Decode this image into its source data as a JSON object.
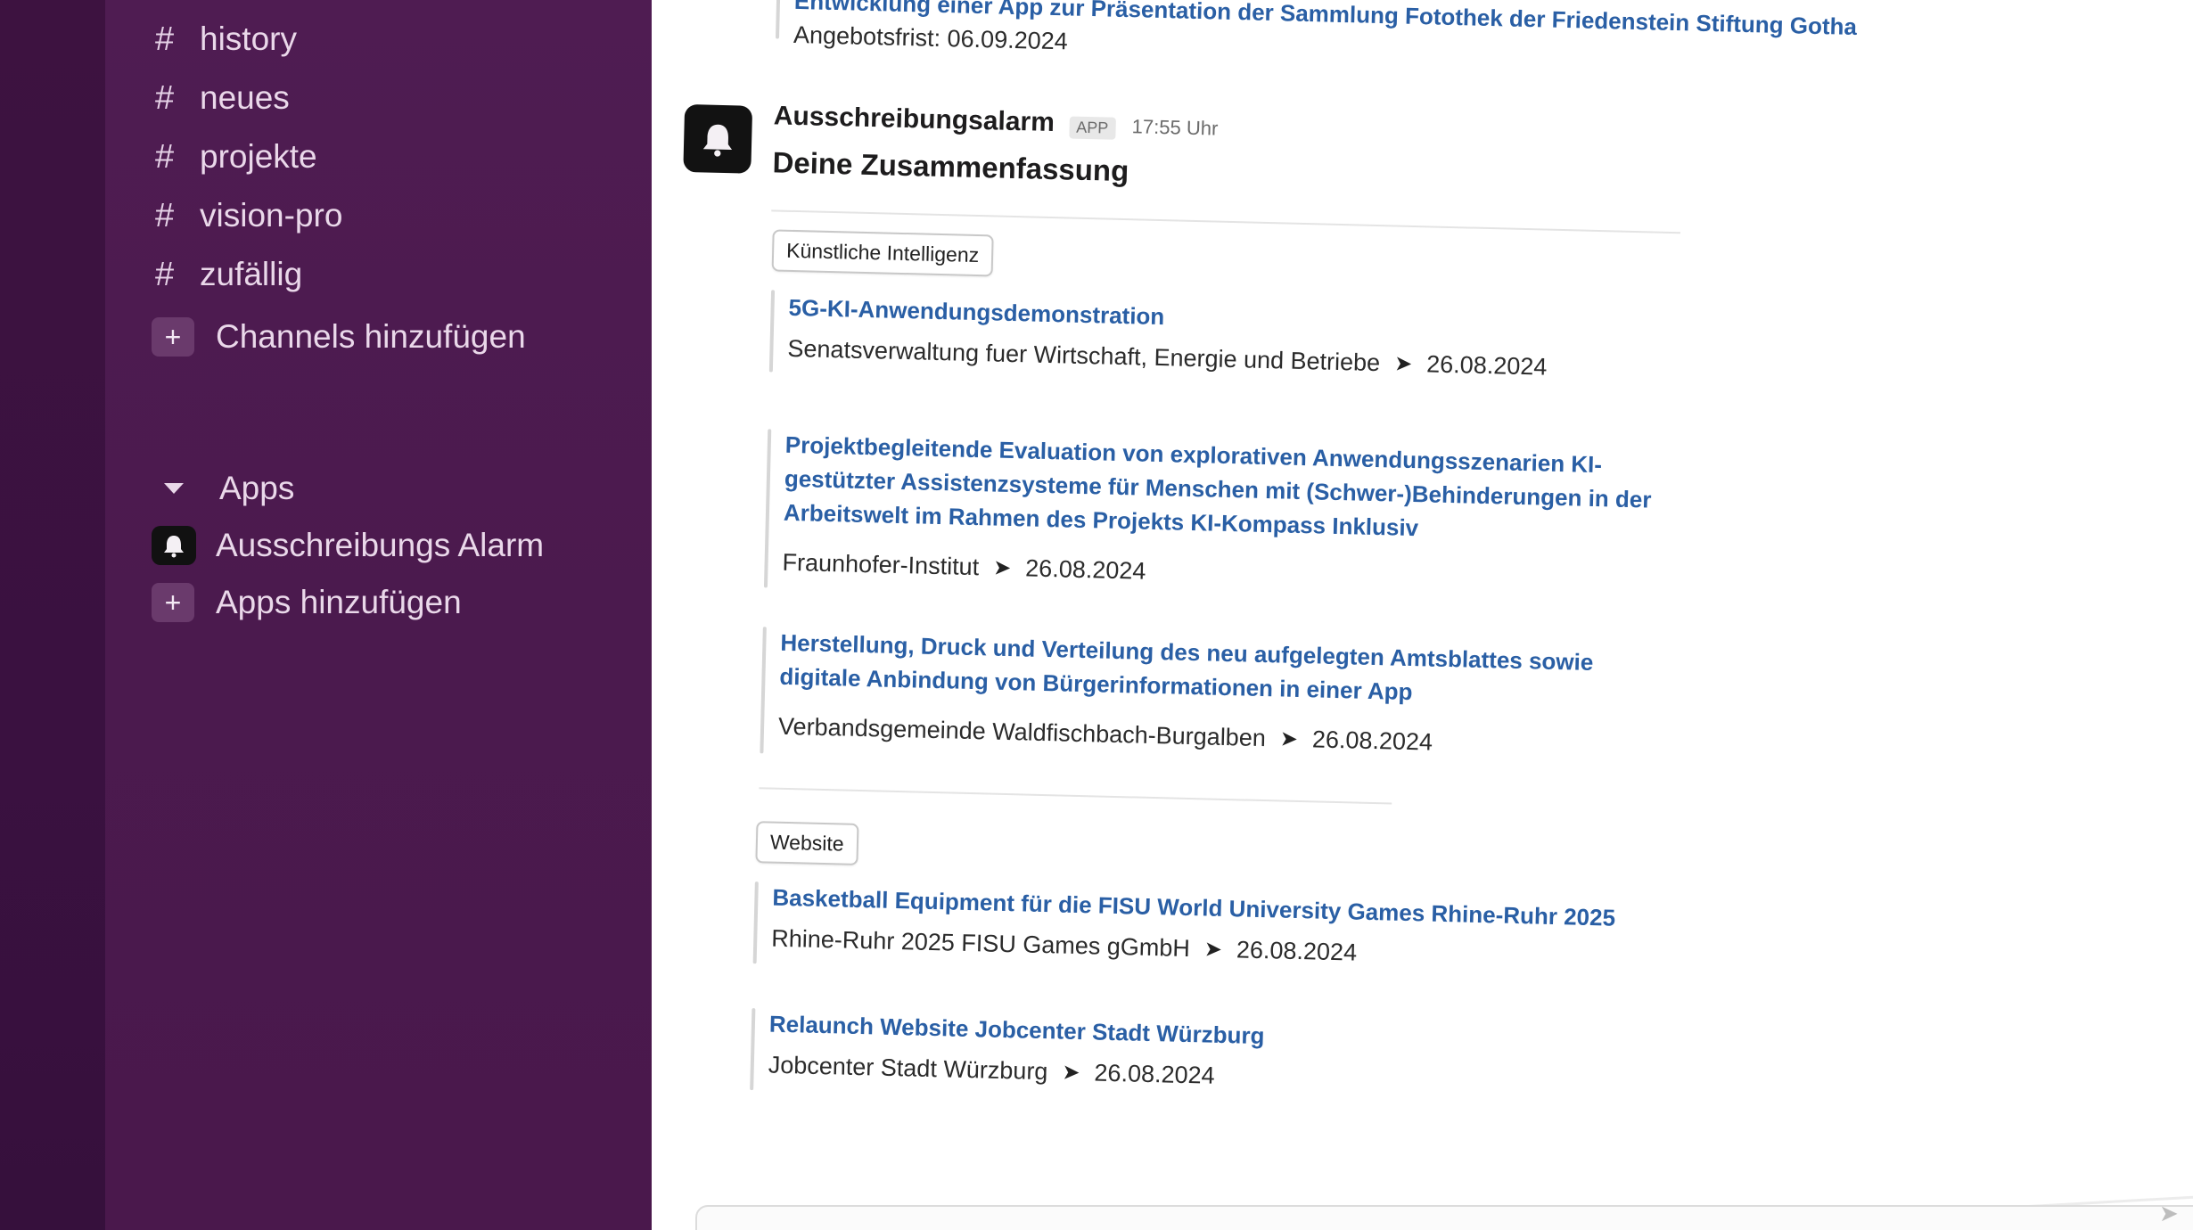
{
  "sidebar": {
    "channels": [
      "history",
      "neues",
      "projekte",
      "vision-pro",
      "zufällig"
    ],
    "add_channels_label": "Channels hinzufügen",
    "apps_header": "Apps",
    "apps": [
      "Ausschreibungs Alarm"
    ],
    "add_apps_label": "Apps hinzufügen"
  },
  "previous_message": {
    "link_fragment": "Entwicklung einer App zur Präsentation der Sammlung Fotothek der Friedenstein Stiftung Gotha",
    "deadline": "Angebotsfrist: 06.09.2024"
  },
  "message": {
    "sender": "Ausschreibungsalarm",
    "badge": "APP",
    "time": "17:55 Uhr",
    "title": "Deine Zusammenfassung",
    "sections": [
      {
        "tag": "Künstliche Intelligenz",
        "items": [
          {
            "title": "5G-KI-Anwendungsdemonstration",
            "org": "Senatsverwaltung fuer Wirtschaft, Energie und Betriebe",
            "date": "26.08.2024"
          },
          {
            "title": "Projektbegleitende Evaluation von explorativen Anwendungsszenarien KI-gestützter Assistenzsysteme für Menschen mit (Schwer-)Behinderungen in der Arbeitswelt im Rahmen des Projekts KI-Kompass Inklusiv",
            "org": "Fraunhofer-Institut",
            "date": "26.08.2024"
          },
          {
            "title": "Herstellung, Druck und Verteilung des neu aufgelegten Amtsblattes sowie digitale Anbindung von Bürgerinformationen in einer App",
            "org": "Verbandsgemeinde Waldfischbach-Burgalben",
            "date": "26.08.2024"
          }
        ]
      },
      {
        "tag": "Website",
        "items": [
          {
            "title": "Basketball Equipment für die FISU World University Games Rhine-Ruhr 2025",
            "org": "Rhine-Ruhr 2025 FISU Games gGmbH",
            "date": "26.08.2024"
          },
          {
            "title": "Relaunch Website Jobcenter Stadt Würzburg",
            "org": "Jobcenter Stadt Würzburg",
            "date": "26.08.2024"
          }
        ]
      }
    ]
  },
  "icons": {
    "hash": "hash-icon",
    "plus": "plus-icon",
    "caret": "caret-down-icon",
    "app": "alarm-bell-icon",
    "send": "send-icon"
  },
  "colors": {
    "sidebar_bg": "#4b1a4e",
    "rail_bg": "#3a1140",
    "link": "#2a5fa5",
    "sidebar_text": "#ead8ea"
  }
}
